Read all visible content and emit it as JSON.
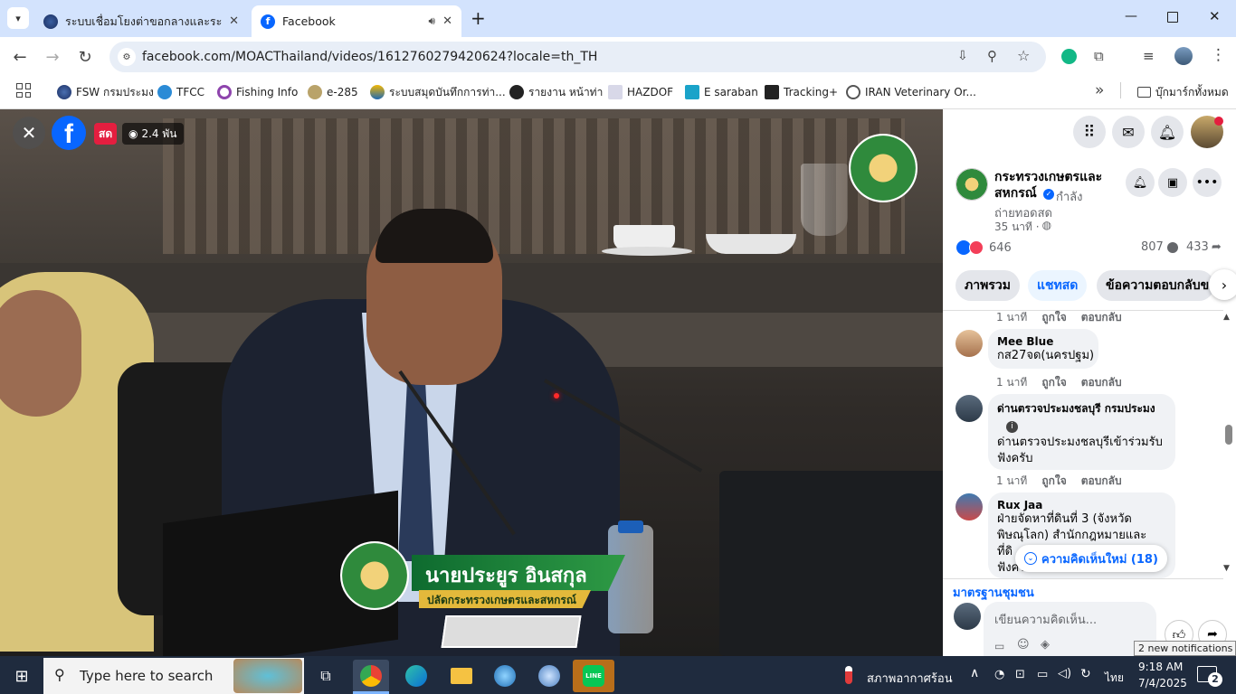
{
  "browser": {
    "tabs": [
      {
        "title": "ระบบเชื่อมโยงต่าขอกลางและระบบสนั่",
        "active": false
      },
      {
        "title": "Facebook",
        "active": true
      }
    ],
    "new_tab": "+",
    "url": "facebook.com/MOACThailand/videos/1612760279420624?locale=th_TH",
    "bookmarks": [
      "FSW กรมประมง",
      "TFCC",
      "Fishing Info",
      "e-285",
      "ระบบสมุดบันทึกการท่า...",
      "รายงาน หน้าท่า",
      "HAZDOF",
      "E saraban",
      "Tracking+",
      "IRAN Veterinary Or..."
    ],
    "all_bookmarks": "บุ๊กมาร์กทั้งหมด",
    "more_bookmarks": "»"
  },
  "video": {
    "live_badge": "สด",
    "viewers": "2.4 พัน",
    "lower_third_name": "นายประยูร อินสกุล",
    "lower_third_title": "ปลัดกระทรวงเกษตรและสหกรณ์"
  },
  "fb": {
    "page_name": "กระทรวงเกษตรและสหกรณ์",
    "status": "กำลังถ่ายทอดสด",
    "status_a": "กำลัง",
    "status_b": "ถ่ายทอดสด",
    "time": "35 นาที ·",
    "reactions": "646",
    "comments_count": "807",
    "shares_count": "433",
    "tabs": [
      "ภาพรวม",
      "แชทสด",
      "ข้อความตอบกลับข"
    ],
    "meta_first": {
      "time": "1 นาที",
      "like": "ถูกใจ",
      "reply": "ตอบกลับ"
    },
    "comments": [
      {
        "name": "Mee Blue",
        "text": "กส27จด(นครปฐม)",
        "time": "1 นาที",
        "like": "ถูกใจ",
        "reply": "ตอบกลับ"
      },
      {
        "name": "ด่านตรวจประมงชลบุรี กรมประมง",
        "text": "ด่านตรวจประมงชลบุรีเข้าร่วมรับฟังครับ",
        "text_a": "ด่านตรวจประมงชลบุรีเข้าร่วมรับ",
        "text_b": "ฟังครับ",
        "time": "1 นาที",
        "like": "ถูกใจ",
        "reply": "ตอบกลับ"
      },
      {
        "name": "Rux Jaa",
        "text_a": "ฝ่ายจัดหาที่ดินที่ 3 (จังหวัด",
        "text_b": "พิษณุโลก) สำนักกฎหมายและ",
        "text_c": "ที่ดิ",
        "text_d": "ฟังครับ"
      }
    ],
    "new_comments": "ความคิดเห็นใหม่ (18)",
    "community": "มาตรฐานชุมชน",
    "input_placeholder": "เขียนความคิดเห็น..."
  },
  "taskbar": {
    "search_placeholder": "Type here to search",
    "weather": "สภาพอากาศร้อน",
    "language": "ไทย",
    "time": "9:18 AM",
    "date": "7/4/2025",
    "notif_count": "2",
    "notif_tooltip": "2 new notifications"
  },
  "colors": {
    "fb_blue": "#0866ff",
    "chrome_tabbar": "#d3e3fd",
    "taskbar": "#1f2b3e",
    "live_red": "#e41e3f"
  }
}
